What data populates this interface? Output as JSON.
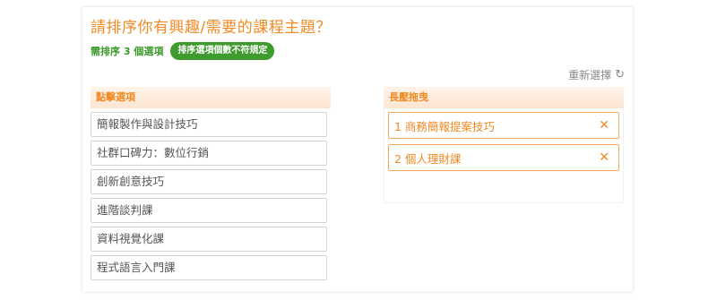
{
  "question": {
    "title": "請排序你有興趣/需要的課程主題？"
  },
  "requirement": {
    "text": "需排序 3 個選項",
    "badge": "排序選項個數不符規定"
  },
  "reset": {
    "label": "重新選擇",
    "icon": "refresh-icon"
  },
  "options_panel": {
    "header": "點擊選項",
    "items": [
      "簡報製作與設計技巧",
      "社群口碑力：數位行銷",
      "創新創意技巧",
      "進階談判課",
      "資料視覺化課",
      "程式語言入門課"
    ]
  },
  "ranked_panel": {
    "header": "長壓拖曳",
    "items": [
      {
        "label": "1 商務簡報提案技巧"
      },
      {
        "label": "2 個人理財課"
      }
    ]
  },
  "colors": {
    "accent": "#f08a24",
    "success": "#3f9b2e"
  }
}
